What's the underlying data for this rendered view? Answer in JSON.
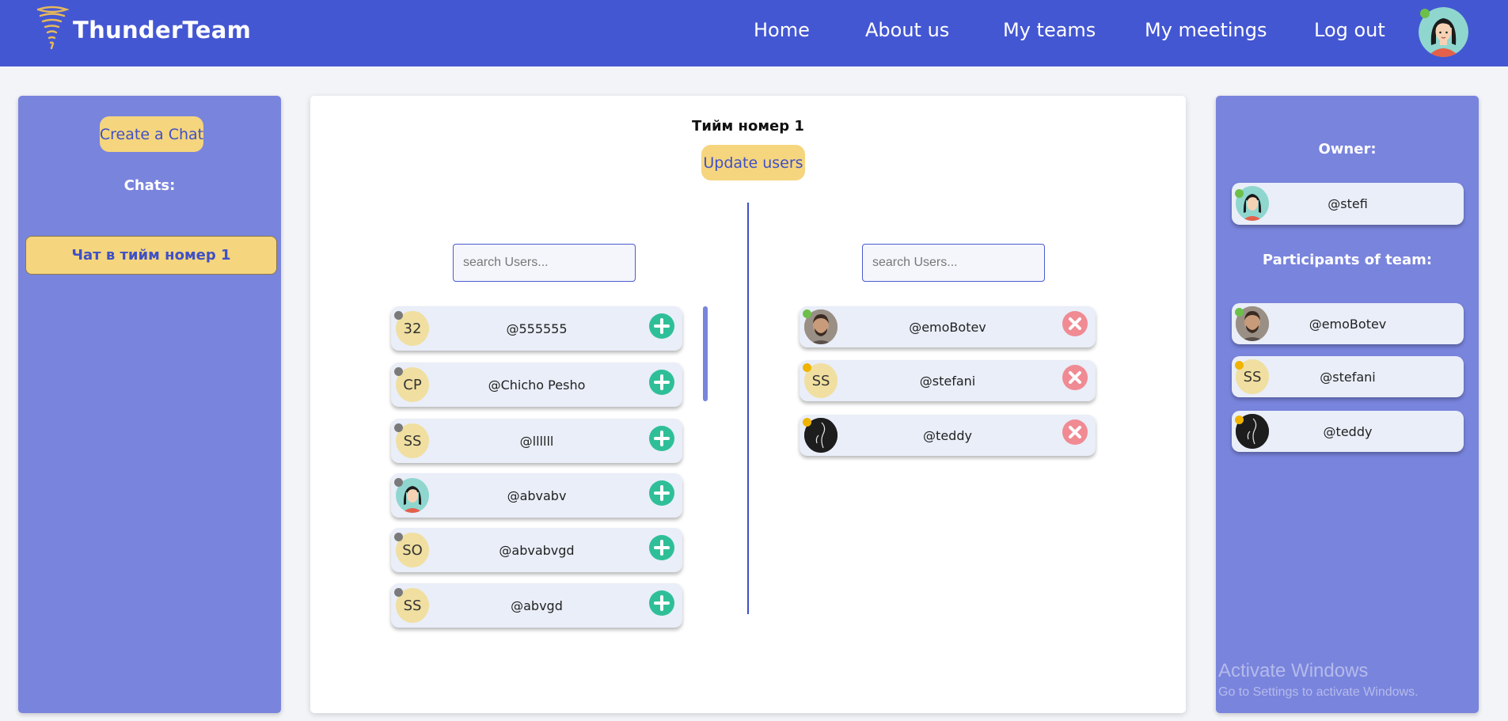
{
  "brand": {
    "name": "ThunderTeam",
    "logo_icon": "tornado-icon"
  },
  "nav": {
    "home": "Home",
    "about": "About us",
    "teams": "My teams",
    "meetings": "My meetings",
    "logout": "Log out"
  },
  "chats_panel": {
    "create_label": "Create a Chat",
    "heading": "Chats:",
    "items": [
      {
        "label": "Чат в тийм номер 1"
      }
    ]
  },
  "team": {
    "title": "Тийм номер 1",
    "update_label": "Update users",
    "search_left_placeholder": "search Users...",
    "search_right_placeholder": "search Users...",
    "available_users": [
      {
        "initials": "32",
        "name": "@555555",
        "status": "offline"
      },
      {
        "initials": "CP",
        "name": "@Chicho Pesho",
        "status": "offline"
      },
      {
        "initials": "SS",
        "name": "@llllll",
        "status": "offline"
      },
      {
        "initials": "",
        "name": "@abvabv",
        "status": "offline",
        "avatar": "girl-avatar"
      },
      {
        "initials": "SO",
        "name": "@abvabvgd",
        "status": "offline"
      },
      {
        "initials": "SS",
        "name": "@abvgd",
        "status": "offline"
      }
    ],
    "team_users": [
      {
        "initials": "",
        "name": "@emoBotev",
        "status": "online",
        "avatar": "man-photo-avatar"
      },
      {
        "initials": "SS",
        "name": "@stefani",
        "status": "away"
      },
      {
        "initials": "",
        "name": "@teddy",
        "status": "away",
        "avatar": "dark-sketch-avatar"
      }
    ]
  },
  "info_panel": {
    "owner_heading": "Owner:",
    "owner": {
      "name": "@stefi",
      "status": "online",
      "avatar": "girl-avatar"
    },
    "participants_heading": "Participants of team:",
    "participants": [
      {
        "initials": "",
        "name": "@emoBotev",
        "status": "online",
        "avatar": "man-photo-avatar"
      },
      {
        "initials": "SS",
        "name": "@stefani",
        "status": "away"
      },
      {
        "initials": "",
        "name": "@teddy",
        "status": "away",
        "avatar": "dark-sketch-avatar"
      }
    ]
  },
  "watermark": {
    "title": "Activate Windows",
    "subtitle": "Go to Settings to activate Windows."
  },
  "colors": {
    "navbar": "#4457d2",
    "panel": "#7984dd",
    "yellow_button": "#f5d57e",
    "add_green": "#2fbf98",
    "remove_red": "#f08a93",
    "status_online": "#6cc04a",
    "status_away": "#f0b400",
    "status_offline": "#7a7a7a"
  }
}
